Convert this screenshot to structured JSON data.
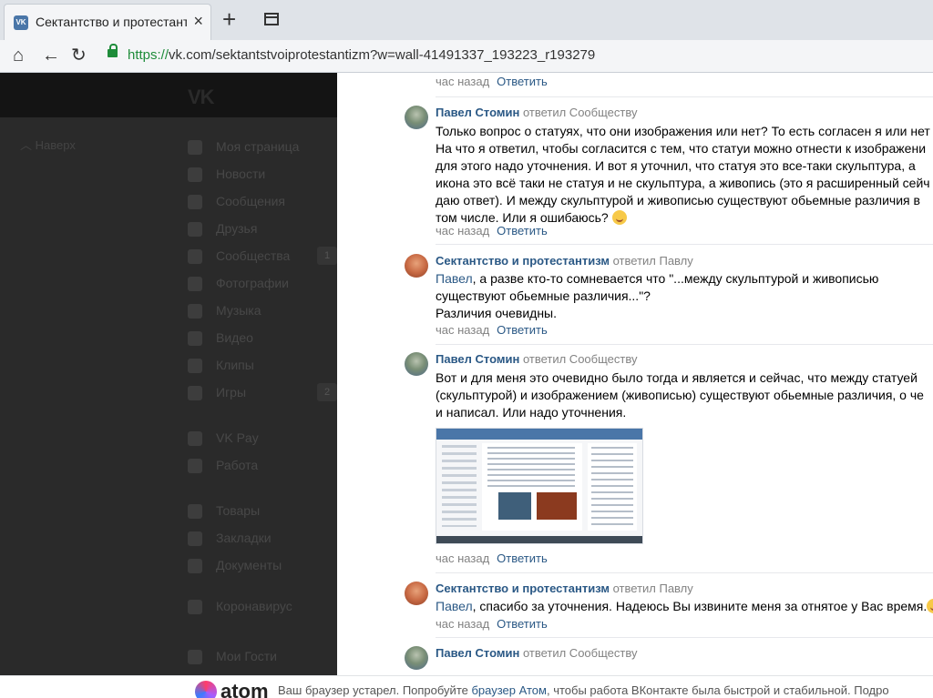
{
  "browser": {
    "tab_title": "Сектантство и протестантизм",
    "tab_close": "×",
    "new_tab": "+",
    "url_green": "https://",
    "url_rest": "vk.com/sektantstvoiprotestantizm?w=wall-41491337_193223_r193279"
  },
  "vk": {
    "logo": "VK",
    "up_link": "Наверх",
    "menu": [
      {
        "label": "Моя страница",
        "icon": "home-icon"
      },
      {
        "label": "Новости",
        "icon": "news-icon"
      },
      {
        "label": "Сообщения",
        "icon": "messages-icon"
      },
      {
        "label": "Друзья",
        "icon": "friends-icon"
      },
      {
        "label": "Сообщества",
        "icon": "groups-icon",
        "count": "1"
      },
      {
        "label": "Фотографии",
        "icon": "camera-icon"
      },
      {
        "label": "Музыка",
        "icon": "music-icon"
      },
      {
        "label": "Видео",
        "icon": "video-icon"
      },
      {
        "label": "Клипы",
        "icon": "clips-icon"
      },
      {
        "label": "Игры",
        "icon": "games-icon",
        "count": "2"
      },
      {
        "label": "VK Pay",
        "icon": "vkpay-icon"
      },
      {
        "label": "Работа",
        "icon": "briefcase-icon"
      },
      {
        "label": "Товары",
        "icon": "bag-icon"
      },
      {
        "label": "Закладки",
        "icon": "star-icon"
      },
      {
        "label": "Документы",
        "icon": "document-icon"
      },
      {
        "label": "Коронавирус",
        "icon": "virus-icon"
      },
      {
        "label": "Мои Гости",
        "icon": "apps-icon"
      }
    ]
  },
  "comments": {
    "c0": {
      "time": "час назад",
      "reply": "Ответить"
    },
    "c1": {
      "author": "Павел Стомин",
      "action": "ответил Сообществу",
      "lines": [
        "Только вопрос о статуях, что они изображения или нет? То есть согласен я или нет",
        "На что я ответил, чтобы согласится с тем, что статуи можно отнести к изображени",
        "для этого надо уточнения. И вот я уточнил, что статуя это все-таки скульптура, а",
        "икона это всё таки не статуя и не скульптура, а живопись (это я расширенный сейч",
        "даю ответ). И между скульптурой и живописью существуют обьемные различия в",
        "том числе. Или я ошибаюсь?"
      ],
      "time": "час назад",
      "reply": "Ответить"
    },
    "c2": {
      "author": "Сектантство и протестантизм",
      "action": "ответил Павлу",
      "mention": "Павел",
      "line1_rest": ", а разве кто-то сомневается что \"...между скульптурой и живописью",
      "line2": "существуют обьемные различия...\"?",
      "line3": "Различия очевидны.",
      "time": "час назад",
      "reply": "Ответить"
    },
    "c3": {
      "author": "Павел Стомин",
      "action": "ответил Сообществу",
      "lines": [
        "Вот и для меня это очевидно было тогда и является и сейчас, что между статуей",
        "(скульптурой) и изображением (живописью) существуют обьемные различия, о че",
        "и написал. Или надо уточнения."
      ],
      "time": "час назад",
      "reply": "Ответить"
    },
    "c4": {
      "author": "Сектантство и протестантизм",
      "action": "ответил Павлу",
      "mention": "Павел",
      "rest": ", спасибо за уточнения. Надеюсь Вы извините меня за отнятое у Вас время.",
      "time": "час назад",
      "reply": "Ответить"
    },
    "c5": {
      "author": "Павел Стомин",
      "action": "ответил Сообществу"
    }
  },
  "banner": {
    "brand": "atom",
    "text_before": "Ваш браузер устарел. Попробуйте ",
    "link": "браузер Атом",
    "text_after": ", чтобы работа ВКонтакте была быстрой и стабильной. Подро"
  },
  "colors": {
    "vk_link": "#2a5885",
    "meta_gray": "#828282",
    "ssl_green": "#1e8c3a"
  }
}
